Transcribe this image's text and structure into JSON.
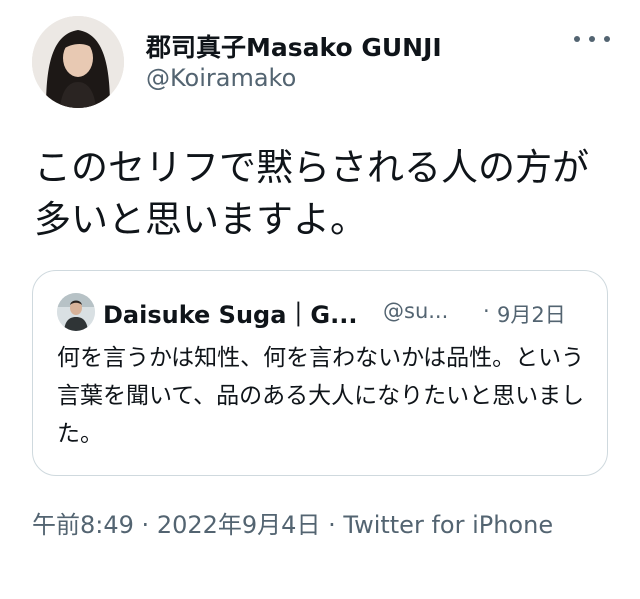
{
  "tweet": {
    "display_name": "郡司真子Masako GUNJI",
    "handle": "@Koiramako",
    "text": "このセリフで黙らされる人の方が多いと思いますよ。",
    "time": "午前8:49",
    "separator": "·",
    "date": "2022年9月4日",
    "source": "Twitter for iPhone"
  },
  "quoted_tweet": {
    "display_name": "Daisuke Suga｜G...",
    "handle": "@su...",
    "separator": "·",
    "date": "9月2日",
    "text": "何を言うかは知性、何を言わないかは品性。という言葉を聞いて、品のある大人になりたいと思いました。"
  },
  "icons": {
    "more": "more-dots-icon"
  },
  "colors": {
    "text_primary": "#0f1419",
    "text_secondary": "#536471",
    "border": "#cfd9de"
  }
}
